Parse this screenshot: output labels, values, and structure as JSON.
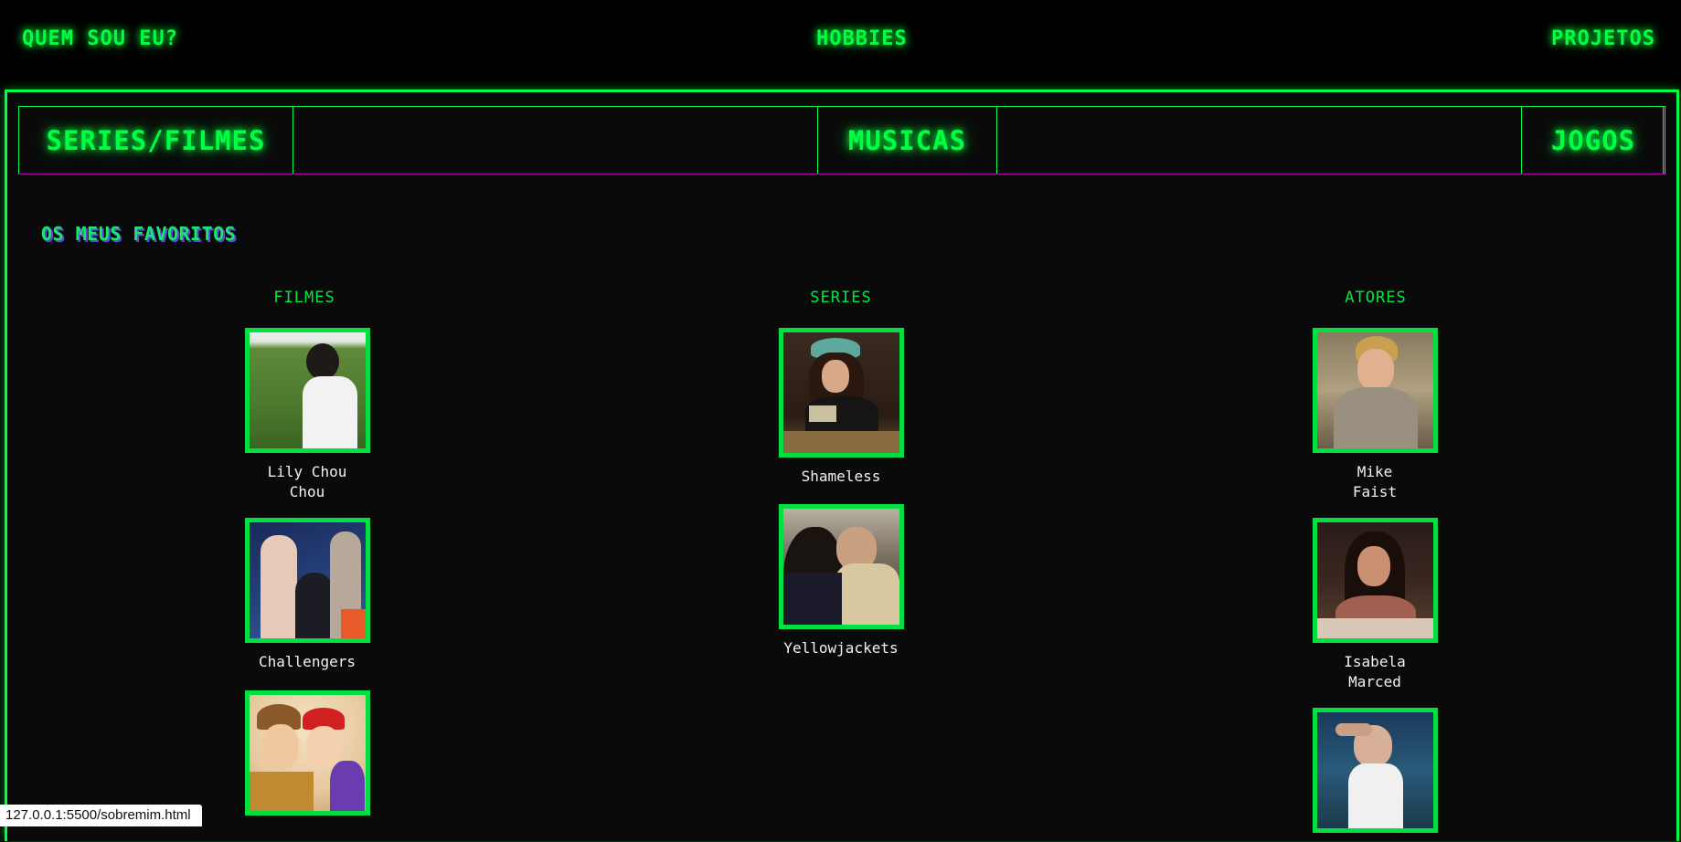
{
  "nav": {
    "left": "QUEM SOU EU?",
    "center": "HOBBIES",
    "right": "PROJETOS"
  },
  "tabs": [
    {
      "label": "SERIES/FILMES"
    },
    {
      "label": "MUSICAS"
    },
    {
      "label": "JOGOS"
    }
  ],
  "favorites": {
    "title": "OS MEUS FAVORITOS",
    "columns": [
      {
        "heading": "FILMES",
        "items": [
          {
            "caption": "Lily Chou Chou"
          },
          {
            "caption": "Challengers"
          },
          {
            "caption": ""
          }
        ]
      },
      {
        "heading": "SERIES",
        "items": [
          {
            "caption": "Shameless"
          },
          {
            "caption": "Yellowjackets"
          }
        ]
      },
      {
        "heading": "ATORES",
        "items": [
          {
            "caption": "Mike Faist"
          },
          {
            "caption": "Isabela Marced"
          },
          {
            "caption": ""
          }
        ]
      }
    ]
  },
  "status_bar": {
    "url": "127.0.0.1:5500/sobremim.html"
  },
  "colors": {
    "accent": "#00ff41",
    "background": "#0a0a0a",
    "tab_bottom": "#b000b0"
  }
}
